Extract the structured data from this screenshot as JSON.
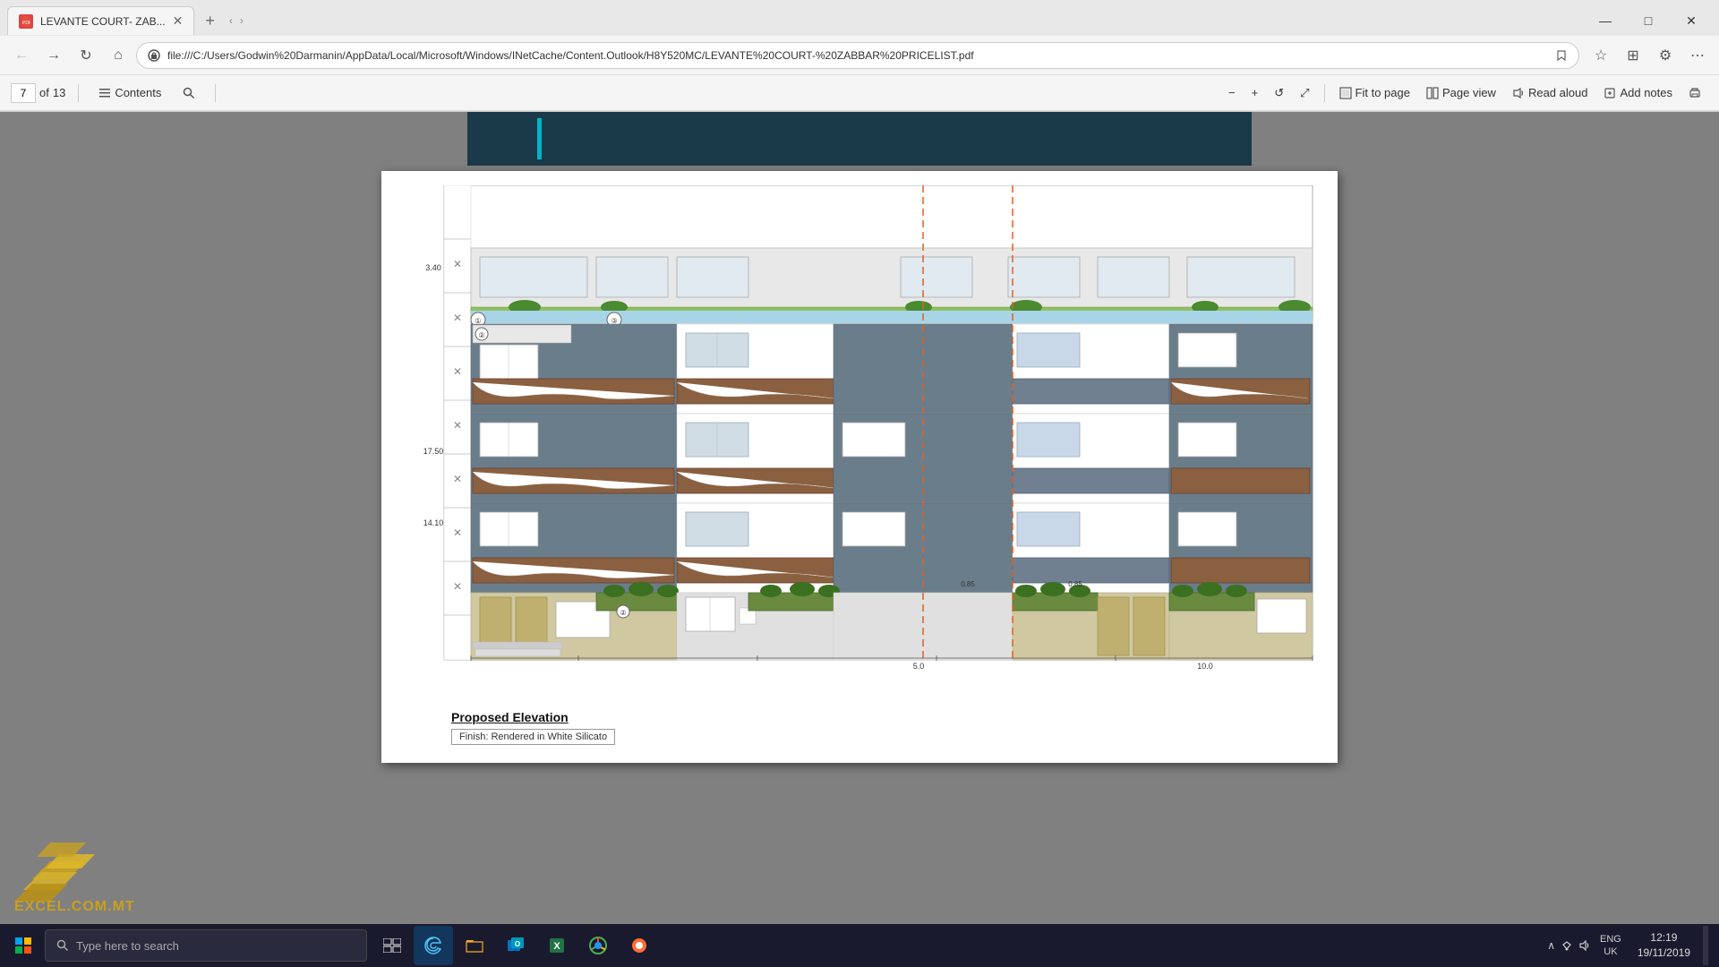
{
  "browser": {
    "tab_title": "LEVANTE COURT- ZAB...",
    "tab_icon": "pdf-icon",
    "address": "file:///C:/Users/Godwin%20Darmanin/AppData/Local/Microsoft/Windows/INetCache/Content.Outlook/H8Y520MC/LEVANTE%20COURT-%20ZABBAR%20PRICELIST.pdf",
    "page_current": "7",
    "page_total": "13"
  },
  "pdf_toolbar": {
    "contents_label": "Contents",
    "fit_to_page": "Fit to page",
    "page_view": "Page view",
    "read_aloud": "Read aloud",
    "add_notes": "Add notes",
    "zoom_out": "−",
    "zoom_in": "+",
    "rotate": "↺",
    "fullscreen": "⤢"
  },
  "drawing": {
    "title": "Proposed Elevation",
    "footer_note": "Finish: Rendered in White Silicato",
    "dimension_1": "3.40",
    "dimension_2": "17.50",
    "dimension_3": "14.10",
    "measure_a": "0.85",
    "measure_b": "0.85",
    "measure_bottom": "5.0",
    "measure_far": "10.0"
  },
  "taskbar": {
    "search_placeholder": "Type here to search",
    "time": "12:19",
    "date": "19/11/2019",
    "language": "ENG\nUK",
    "start_icon": "⊞",
    "search_icon": "🔍"
  },
  "windows_controls": {
    "minimize": "—",
    "maximize": "□",
    "close": "✕"
  }
}
